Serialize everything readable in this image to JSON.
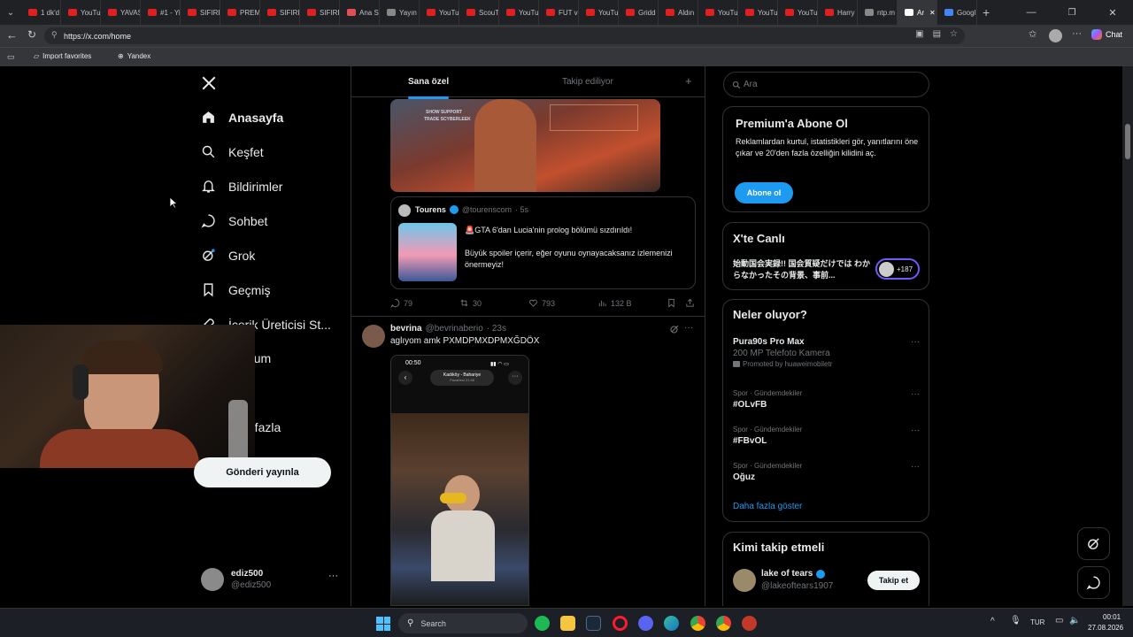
{
  "browser": {
    "tabs": [
      {
        "label": "1 dk'd",
        "color": "#e02020"
      },
      {
        "label": "YouTu",
        "color": "#e02020"
      },
      {
        "label": "YAVAŞ",
        "color": "#e02020"
      },
      {
        "label": "#1 - Yi",
        "color": "#e02020"
      },
      {
        "label": "SIFIRD",
        "color": "#e02020"
      },
      {
        "label": "PREMI",
        "color": "#e02020"
      },
      {
        "label": "SIFIRD",
        "color": "#e02020"
      },
      {
        "label": "SIFIRD",
        "color": "#e02020"
      },
      {
        "label": "Ana S",
        "color": "#e05050"
      },
      {
        "label": "Yayın",
        "color": "#888888"
      },
      {
        "label": "YouTu",
        "color": "#e02020"
      },
      {
        "label": "ScouT",
        "color": "#e02020"
      },
      {
        "label": "YouTu",
        "color": "#e02020"
      },
      {
        "label": "FUT vi",
        "color": "#e02020"
      },
      {
        "label": "YouTu",
        "color": "#e02020"
      },
      {
        "label": "Gridd",
        "color": "#e02020"
      },
      {
        "label": "Aldın",
        "color": "#e02020"
      },
      {
        "label": "YouTu",
        "color": "#e02020"
      },
      {
        "label": "YouTu",
        "color": "#e02020"
      },
      {
        "label": "YouTu",
        "color": "#e02020"
      },
      {
        "label": "Harry",
        "color": "#e02020"
      },
      {
        "label": "ntp.m",
        "color": "#888888"
      },
      {
        "label": "Ar",
        "color": "#ffffff",
        "active": true
      },
      {
        "label": "Googl",
        "color": "#4285f4"
      }
    ],
    "url": "https://x.com/home",
    "chat_label": "Chat",
    "favorites": [
      {
        "label": "Import favorites"
      },
      {
        "label": "Yandex"
      }
    ]
  },
  "sidebar": {
    "items": [
      {
        "label": "Anasayfa",
        "icon": "home-icon"
      },
      {
        "label": "Keşfet",
        "icon": "search-icon"
      },
      {
        "label": "Bildirimler",
        "icon": "bell-icon"
      },
      {
        "label": "Sohbet",
        "icon": "chat-icon"
      },
      {
        "label": "Grok",
        "icon": "grok-icon"
      },
      {
        "label": "Geçmiş",
        "icon": "bookmark-icon"
      },
      {
        "label": "İçerik Üreticisi St...",
        "icon": "rocket-icon"
      },
      {
        "label": "mium",
        "icon": ""
      },
      {
        "label": "l",
        "icon": ""
      },
      {
        "label": "a fazla",
        "icon": ""
      }
    ],
    "post_button": "Gönderi yayınla",
    "account": {
      "name": "ediz500",
      "handle": "@ediz500"
    }
  },
  "feed": {
    "tabs": [
      {
        "label": "Sana özel",
        "active": true
      },
      {
        "label": "Takip ediliyor",
        "active": false
      }
    ],
    "image_caption_lines": [
      "SHOW SUPPORT",
      "TRADE SCYBERLEEK"
    ],
    "quote": {
      "name": "Tourens",
      "handle": "@tourenscom",
      "time": "· 5s",
      "line1": "🚨GTA 6'dan Lucia'nin prolog bölümü sızdırıldı!",
      "line2": "Büyük spoiler içerir, eğer oyunu oynayacaksanız izlemenizi önermeyiz!"
    },
    "actions": {
      "replies": "79",
      "reposts": "30",
      "likes": "793",
      "views": "132 B"
    },
    "post2": {
      "name": "bevrina",
      "handle": "@bevrinaberio",
      "time": "· 23s",
      "text": "aglıyom amk PXMDPMXDPMXĞDÖX",
      "phone_time": "00:50",
      "phone_title": "Kadıköy - Bahariye",
      "phone_sub": "Pazartesi 21:46"
    }
  },
  "right": {
    "search_placeholder": "Ara",
    "premium": {
      "title": "Premium'a Abone Ol",
      "text": "Reklamlardan kurtul, istatistikleri gör, yanıtlarını öne çıkar ve 20'den fazla özelliğin kilidini aç.",
      "button": "Abone ol"
    },
    "live": {
      "title": "X'te Canlı",
      "text": "始動国会実録!! 国会質疑だけでは わからなかったその背景、事前...",
      "count": "+187"
    },
    "trends": {
      "title": "Neler oluyor?",
      "items": [
        {
          "title": "Pura90s Pro Max",
          "sub": "200 MP Telefoto Kamera",
          "meta": "Promoted by huaweimobiletr"
        },
        {
          "meta": "Spor · Gündemdekiler",
          "title": "#OLvFB"
        },
        {
          "meta": "Spor · Gündemdekiler",
          "title": "#FBvOL"
        },
        {
          "meta": "Spor · Gündemdekiler",
          "title": "Oğuz"
        }
      ],
      "more": "Daha fazla göster"
    },
    "follow": {
      "title": "Kimi takip etmeli",
      "name": "lake of tears",
      "handle": "@lakeoftears1907",
      "button": "Takip et"
    }
  },
  "taskbar": {
    "search": "Search",
    "lang": "TUR",
    "time": "00:01",
    "date": "27.08.2026"
  },
  "colors": {
    "accent": "#1d9bf0",
    "bg": "#000000",
    "border": "#2f3336",
    "muted": "#71767b"
  }
}
